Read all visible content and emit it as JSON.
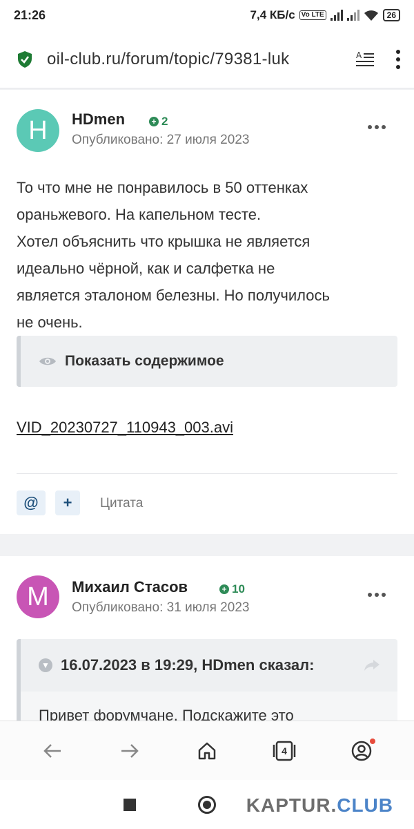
{
  "status": {
    "time": "21:26",
    "speed": "7,4 КБ/с",
    "volte": "Vo LTE",
    "battery": "26"
  },
  "browser": {
    "url": "oil-club.ru/forum/topic/79381-luk",
    "tabs_count": "4"
  },
  "posts": [
    {
      "avatar_letter": "H",
      "avatar_color": "#5bc9b5",
      "author": "HDmen",
      "reputation": "2",
      "date": "Опубликовано: 27 июля 2023",
      "body_lines": [
        "То что мне не понравилось в 50 оттенках",
        "ораньжевого. На капельном тесте.",
        "Хотел объяснить что крышка не является",
        "идеально чёрной, как и салфетка не",
        "является эталоном белезны. Но получилось",
        "не очень."
      ],
      "spoiler_label": "Показать содержимое",
      "attachment": "VID_20230727_110943_003.avi",
      "mention_label": "@",
      "plus_label": "+",
      "quote_label": "Цитата"
    },
    {
      "avatar_letter": "M",
      "avatar_color": "#c855b5",
      "author": "Михаил Стасов",
      "reputation": "10",
      "date": "Опубликовано: 31 июля 2023",
      "quote_header": "16.07.2023 в 19:29, HDmen сказал:",
      "quote_text": "Привет форумчане. Подскажите это"
    }
  ],
  "watermark": {
    "part1": "KAPTUR.",
    "part2": "CLUB"
  },
  "colors": {
    "accent_green": "#2e8b57",
    "link_blue": "#1d4f7a"
  }
}
